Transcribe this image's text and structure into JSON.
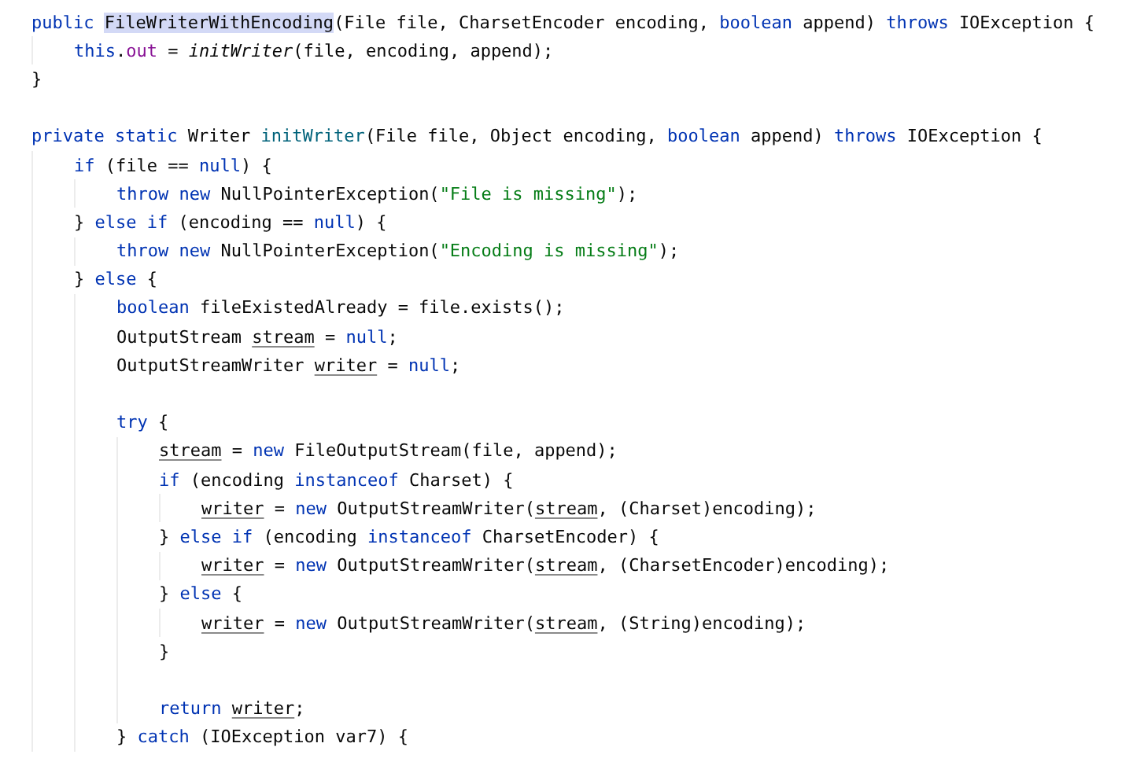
{
  "editor": {
    "lines": [
      {
        "kind": "code",
        "tokens": [
          {
            "kind": "kw",
            "text": "public "
          },
          {
            "kind": "hl",
            "text": "FileWriterWithEncoding"
          },
          {
            "kind": "t",
            "text": "(File file, CharsetEncoder encoding, "
          },
          {
            "kind": "kw",
            "text": "boolean "
          },
          {
            "kind": "t",
            "text": "append) "
          },
          {
            "kind": "kw",
            "text": "throws "
          },
          {
            "kind": "t",
            "text": "IOException {"
          }
        ],
        "children": [
          {
            "kind": "code",
            "tokens": [
              {
                "kind": "kw",
                "text": "this"
              },
              {
                "kind": "t",
                "text": "."
              },
              {
                "kind": "fld",
                "text": "out"
              },
              {
                "kind": "t",
                "text": " = "
              },
              {
                "kind": "ital",
                "text": "initWriter"
              },
              {
                "kind": "t",
                "text": "(file, encoding, append);"
              }
            ]
          }
        ]
      },
      {
        "kind": "code",
        "tokens": [
          {
            "kind": "t",
            "text": "}"
          }
        ]
      },
      {
        "kind": "blank"
      },
      {
        "kind": "code",
        "tokens": [
          {
            "kind": "kw",
            "text": "private static "
          },
          {
            "kind": "t",
            "text": "Writer "
          },
          {
            "kind": "decl",
            "text": "initWriter"
          },
          {
            "kind": "t",
            "text": "(File file, Object encoding, "
          },
          {
            "kind": "kw",
            "text": "boolean "
          },
          {
            "kind": "t",
            "text": "append) "
          },
          {
            "kind": "kw",
            "text": "throws "
          },
          {
            "kind": "t",
            "text": "IOException {"
          }
        ],
        "children": [
          {
            "kind": "code",
            "tokens": [
              {
                "kind": "kw",
                "text": "if "
              },
              {
                "kind": "t",
                "text": "(file == "
              },
              {
                "kind": "kw",
                "text": "null"
              },
              {
                "kind": "t",
                "text": ") {"
              }
            ],
            "children": [
              {
                "kind": "code",
                "tokens": [
                  {
                    "kind": "kw",
                    "text": "throw new "
                  },
                  {
                    "kind": "t",
                    "text": "NullPointerException("
                  },
                  {
                    "kind": "str",
                    "text": "\"File is missing\""
                  },
                  {
                    "kind": "t",
                    "text": ");"
                  }
                ]
              }
            ]
          },
          {
            "kind": "code",
            "tokens": [
              {
                "kind": "t",
                "text": "} "
              },
              {
                "kind": "kw",
                "text": "else if "
              },
              {
                "kind": "t",
                "text": "(encoding == "
              },
              {
                "kind": "kw",
                "text": "null"
              },
              {
                "kind": "t",
                "text": ") {"
              }
            ],
            "children": [
              {
                "kind": "code",
                "tokens": [
                  {
                    "kind": "kw",
                    "text": "throw new "
                  },
                  {
                    "kind": "t",
                    "text": "NullPointerException("
                  },
                  {
                    "kind": "str",
                    "text": "\"Encoding is missing\""
                  },
                  {
                    "kind": "t",
                    "text": ");"
                  }
                ]
              }
            ]
          },
          {
            "kind": "code",
            "tokens": [
              {
                "kind": "t",
                "text": "} "
              },
              {
                "kind": "kw",
                "text": "else "
              },
              {
                "kind": "t",
                "text": "{"
              }
            ],
            "children": [
              {
                "kind": "code",
                "tokens": [
                  {
                    "kind": "kw",
                    "text": "boolean "
                  },
                  {
                    "kind": "t",
                    "text": "fileExistedAlready = file.exists();"
                  }
                ]
              },
              {
                "kind": "code",
                "tokens": [
                  {
                    "kind": "t",
                    "text": "OutputStream "
                  },
                  {
                    "kind": "var",
                    "text": "stream"
                  },
                  {
                    "kind": "t",
                    "text": " = "
                  },
                  {
                    "kind": "kw",
                    "text": "null"
                  },
                  {
                    "kind": "t",
                    "text": ";"
                  }
                ]
              },
              {
                "kind": "code",
                "tokens": [
                  {
                    "kind": "t",
                    "text": "OutputStreamWriter "
                  },
                  {
                    "kind": "var",
                    "text": "writer"
                  },
                  {
                    "kind": "t",
                    "text": " = "
                  },
                  {
                    "kind": "kw",
                    "text": "null"
                  },
                  {
                    "kind": "t",
                    "text": ";"
                  }
                ]
              },
              {
                "kind": "blank"
              },
              {
                "kind": "code",
                "tokens": [
                  {
                    "kind": "kw",
                    "text": "try "
                  },
                  {
                    "kind": "t",
                    "text": "{"
                  }
                ],
                "children": [
                  {
                    "kind": "code",
                    "tokens": [
                      {
                        "kind": "var",
                        "text": "stream"
                      },
                      {
                        "kind": "t",
                        "text": " = "
                      },
                      {
                        "kind": "kw",
                        "text": "new "
                      },
                      {
                        "kind": "t",
                        "text": "FileOutputStream(file, append);"
                      }
                    ]
                  },
                  {
                    "kind": "code",
                    "tokens": [
                      {
                        "kind": "kw",
                        "text": "if "
                      },
                      {
                        "kind": "t",
                        "text": "(encoding "
                      },
                      {
                        "kind": "kw",
                        "text": "instanceof "
                      },
                      {
                        "kind": "t",
                        "text": "Charset) {"
                      }
                    ],
                    "children": [
                      {
                        "kind": "code",
                        "tokens": [
                          {
                            "kind": "var",
                            "text": "writer"
                          },
                          {
                            "kind": "t",
                            "text": " = "
                          },
                          {
                            "kind": "kw",
                            "text": "new "
                          },
                          {
                            "kind": "t",
                            "text": "OutputStreamWriter("
                          },
                          {
                            "kind": "var",
                            "text": "stream"
                          },
                          {
                            "kind": "t",
                            "text": ", (Charset)encoding);"
                          }
                        ]
                      }
                    ]
                  },
                  {
                    "kind": "code",
                    "tokens": [
                      {
                        "kind": "t",
                        "text": "} "
                      },
                      {
                        "kind": "kw",
                        "text": "else if "
                      },
                      {
                        "kind": "t",
                        "text": "(encoding "
                      },
                      {
                        "kind": "kw",
                        "text": "instanceof "
                      },
                      {
                        "kind": "t",
                        "text": "CharsetEncoder) {"
                      }
                    ],
                    "children": [
                      {
                        "kind": "code",
                        "tokens": [
                          {
                            "kind": "var",
                            "text": "writer"
                          },
                          {
                            "kind": "t",
                            "text": " = "
                          },
                          {
                            "kind": "kw",
                            "text": "new "
                          },
                          {
                            "kind": "t",
                            "text": "OutputStreamWriter("
                          },
                          {
                            "kind": "var",
                            "text": "stream"
                          },
                          {
                            "kind": "t",
                            "text": ", (CharsetEncoder)encoding);"
                          }
                        ]
                      }
                    ]
                  },
                  {
                    "kind": "code",
                    "tokens": [
                      {
                        "kind": "t",
                        "text": "} "
                      },
                      {
                        "kind": "kw",
                        "text": "else "
                      },
                      {
                        "kind": "t",
                        "text": "{"
                      }
                    ],
                    "children": [
                      {
                        "kind": "code",
                        "tokens": [
                          {
                            "kind": "var",
                            "text": "writer"
                          },
                          {
                            "kind": "t",
                            "text": " = "
                          },
                          {
                            "kind": "kw",
                            "text": "new "
                          },
                          {
                            "kind": "t",
                            "text": "OutputStreamWriter("
                          },
                          {
                            "kind": "var",
                            "text": "stream"
                          },
                          {
                            "kind": "t",
                            "text": ", (String)encoding);"
                          }
                        ]
                      }
                    ]
                  },
                  {
                    "kind": "code",
                    "tokens": [
                      {
                        "kind": "t",
                        "text": "}"
                      }
                    ]
                  },
                  {
                    "kind": "blank"
                  },
                  {
                    "kind": "code",
                    "tokens": [
                      {
                        "kind": "kw",
                        "text": "return "
                      },
                      {
                        "kind": "var",
                        "text": "writer"
                      },
                      {
                        "kind": "t",
                        "text": ";"
                      }
                    ]
                  }
                ]
              },
              {
                "kind": "code",
                "tokens": [
                  {
                    "kind": "t",
                    "text": "} "
                  },
                  {
                    "kind": "kw",
                    "text": "catch "
                  },
                  {
                    "kind": "t",
                    "text": "(IOException var7) {"
                  }
                ]
              }
            ]
          }
        ]
      }
    ]
  }
}
